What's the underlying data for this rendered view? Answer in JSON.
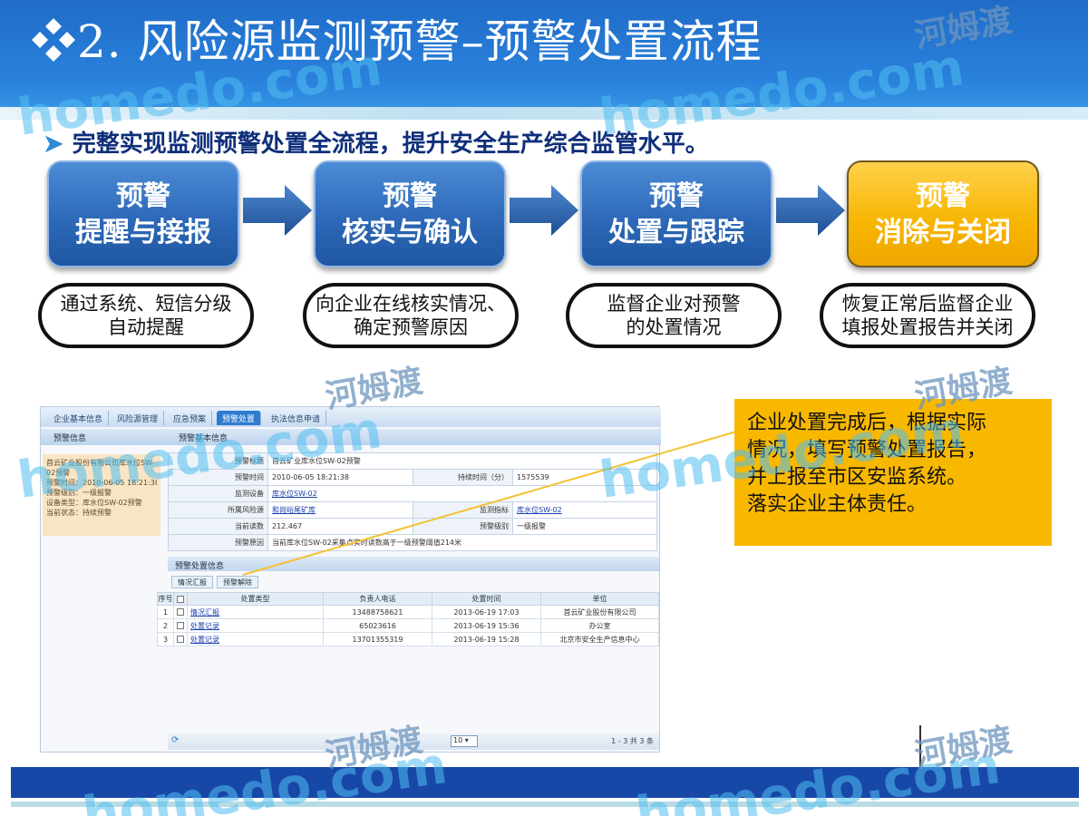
{
  "header": {
    "title": "❖2. 风险源监测预警–预警处置流程"
  },
  "subtitle": {
    "bullet": "➤",
    "text": "完整实现监测预警处置全流程，提升安全生产综合监管水平。"
  },
  "steps": [
    {
      "line1": "预警",
      "line2": "提醒与接报",
      "desc1": "通过系统、短信分级",
      "desc2": "自动提醒"
    },
    {
      "line1": "预警",
      "line2": "核实与确认",
      "desc1": "向企业在线核实情况、",
      "desc2": "确定预警原因"
    },
    {
      "line1": "预警",
      "line2": "处置与跟踪",
      "desc1": "监督企业对预警",
      "desc2": "的处置情况"
    },
    {
      "line1": "预警",
      "line2": "消除与关闭",
      "desc1": "恢复正常后监督企业",
      "desc2": "填报处置报告并关闭"
    }
  ],
  "app": {
    "nav": [
      "企业基本信息",
      "风险源管理",
      "应急预案",
      "预警处置",
      "执法信息申请"
    ],
    "bar2_left": "预警信息",
    "bar2_right": "预警基本信息",
    "left_panel": [
      "首云矿业股份有限公司库水位SW-",
      "02预警",
      "预警时间：2010-06-05 18:21:38",
      "预警级别：一级报警",
      "设备类型：库水位SW-02预警",
      "当前状态：持续预警"
    ],
    "info": {
      "title_label": "预警标题",
      "title_value": "首云矿业库水位SW-02预警",
      "time_label": "预警时间",
      "time_value": "2010-06-05 18:21:38",
      "duration_label": "持续时间（分）",
      "duration_value": "1575539",
      "device_label": "监测设备",
      "device_value": "库水位SW-02",
      "source_label": "所属风险源",
      "source_value": "和尚峪尾矿库",
      "indicator_label": "监测指标",
      "indicator_value": "库水位SW-02",
      "reading_label": "当前读数",
      "reading_value": "212.467",
      "level_label": "预警级别",
      "level_value": "一级报警",
      "reason_label": "预警原因",
      "reason_value": "当前库水位SW-02采集点实时读数高于一级预警阈值214米"
    },
    "section_title": "预警处置信息",
    "subtabs": [
      "情况汇报",
      "预警解除"
    ],
    "grid": {
      "headers": [
        "序号",
        "处置类型",
        "负责人电话",
        "处置时间",
        "单位"
      ],
      "rows": [
        {
          "no": "1",
          "type": "情况汇报",
          "phone": "13488758621",
          "time": "2013-06-19 17:03",
          "unit": "首云矿业股份有限公司"
        },
        {
          "no": "2",
          "type": "处置记录",
          "phone": "65023616",
          "time": "2013-06-19 15:36",
          "unit": "办公室"
        },
        {
          "no": "3",
          "type": "处置记录",
          "phone": "13701355319",
          "time": "2013-06-19 15:28",
          "unit": "北京市安全生产信息中心"
        }
      ]
    },
    "pager": {
      "page_size": "10",
      "count": "1 - 3  共 3 条"
    }
  },
  "callout": {
    "lines": [
      "企业处置完成后，根据实际",
      "情况，填写预警处置报告，",
      "并上报至市区安监系统。",
      "落实企业主体责任。"
    ]
  },
  "watermarks": {
    "home": "homedo.com",
    "cn": "河姆渡"
  },
  "colors": {
    "header_blue": "#1f6cc8",
    "box_blue": "#2d69b8",
    "box_yellow": "#f7b400",
    "footer_blue": "#1748a8",
    "callout": "#f8b800"
  }
}
